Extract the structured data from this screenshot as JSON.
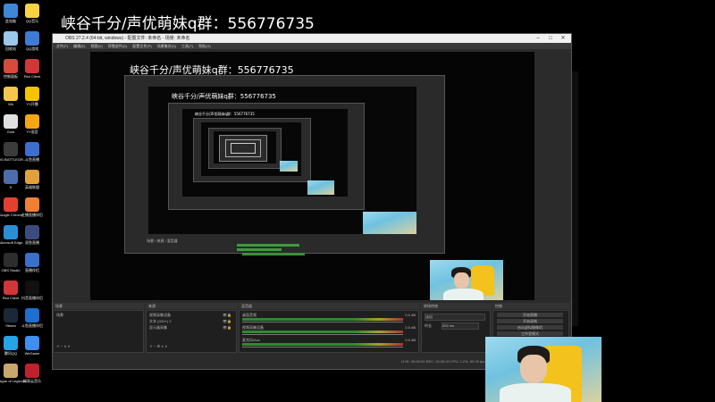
{
  "overlay": {
    "text": "峡谷千分/声优萌妹q群：556776735"
  },
  "desktop_icons_left": [
    {
      "label": "此电脑",
      "color": "#3d88d6"
    },
    {
      "label": "回收站",
      "color": "#9cc7e8"
    },
    {
      "label": "控制面板",
      "color": "#d84a3a"
    },
    {
      "label": "Wk",
      "color": "#f6c64a"
    },
    {
      "label": "Gold",
      "color": "#e0e0e0"
    },
    {
      "label": "ROG BATTLEGR...",
      "color": "#3b3b3b"
    },
    {
      "label": "5",
      "color": "#4c6cab"
    },
    {
      "label": "Google Chrome",
      "color": "#e3412f"
    },
    {
      "label": "Microsoft Edge",
      "color": "#2b8fd6"
    },
    {
      "label": "OBS Studio",
      "color": "#2d2d2d"
    },
    {
      "label": "Riot Client",
      "color": "#d13639"
    },
    {
      "label": "Steam",
      "color": "#1b2838"
    },
    {
      "label": "腾讯QQ",
      "color": "#28a3e6"
    },
    {
      "label": "League of Legends",
      "color": "#c8a86a"
    }
  ],
  "desktop_icons_right": [
    {
      "label": "QQ音乐",
      "color": "#f8d341"
    },
    {
      "label": "QQ游戏",
      "color": "#3e7bd5"
    },
    {
      "label": "Riot Client",
      "color": "#d13639"
    },
    {
      "label": "YY开播",
      "color": "#f4c400"
    },
    {
      "label": "YY语音",
      "color": "#f3a715"
    },
    {
      "label": "斗鱼直播",
      "color": "#3d6fcf"
    },
    {
      "label": "英雄联盟",
      "color": "#e0a13a"
    },
    {
      "label": "主播直播伴侣",
      "color": "#f08030"
    },
    {
      "label": "双鱼直播",
      "color": "#3b4b7e"
    },
    {
      "label": "直播伴侣",
      "color": "#3a6fca"
    },
    {
      "label": "抖音直播伴侣",
      "color": "#111"
    },
    {
      "label": "斗鱼直播伴侣",
      "color": "#1f6fd0"
    },
    {
      "label": "WeGame",
      "color": "#3f8ff0"
    },
    {
      "label": "网易云音乐",
      "color": "#c0212f"
    }
  ],
  "obs": {
    "title": "OBS 27.2.4 (64-bit, windows) - 配置文件: 未命名 - 场景: 未命名",
    "menu": [
      "文件(F)",
      "编辑(E)",
      "视图(V)",
      "停靠部件(D)",
      "配置文件(P)",
      "场景集合(S)",
      "工具(T)",
      "帮助(H)"
    ],
    "docks": {
      "scenes": "场景",
      "sources": "来源",
      "mixer": "混音器",
      "transitions": "转场特效",
      "controls": "控制"
    },
    "scene_item": "场景",
    "sources": [
      "视频采集设备",
      "文本 (GDI+) 2",
      "显示器采集"
    ],
    "mixer": [
      {
        "name": "桌面音频",
        "level": "0.0 dB"
      },
      {
        "name": "视频采集设备",
        "level": "0.0 dB"
      },
      {
        "name": "麦克风/Aux",
        "level": "0.0 dB"
      }
    ],
    "transition": {
      "type": "淡出",
      "duration_label": "时长",
      "duration": "300 ms"
    },
    "controls": [
      "开始直播",
      "开始录制",
      "启动虚拟摄像机",
      "工作室模式",
      "设置",
      "退出"
    ],
    "status": "LIVE: 00:00:00   REC: 00:00:00   CPU: 1.2%, 60.00 fps"
  }
}
